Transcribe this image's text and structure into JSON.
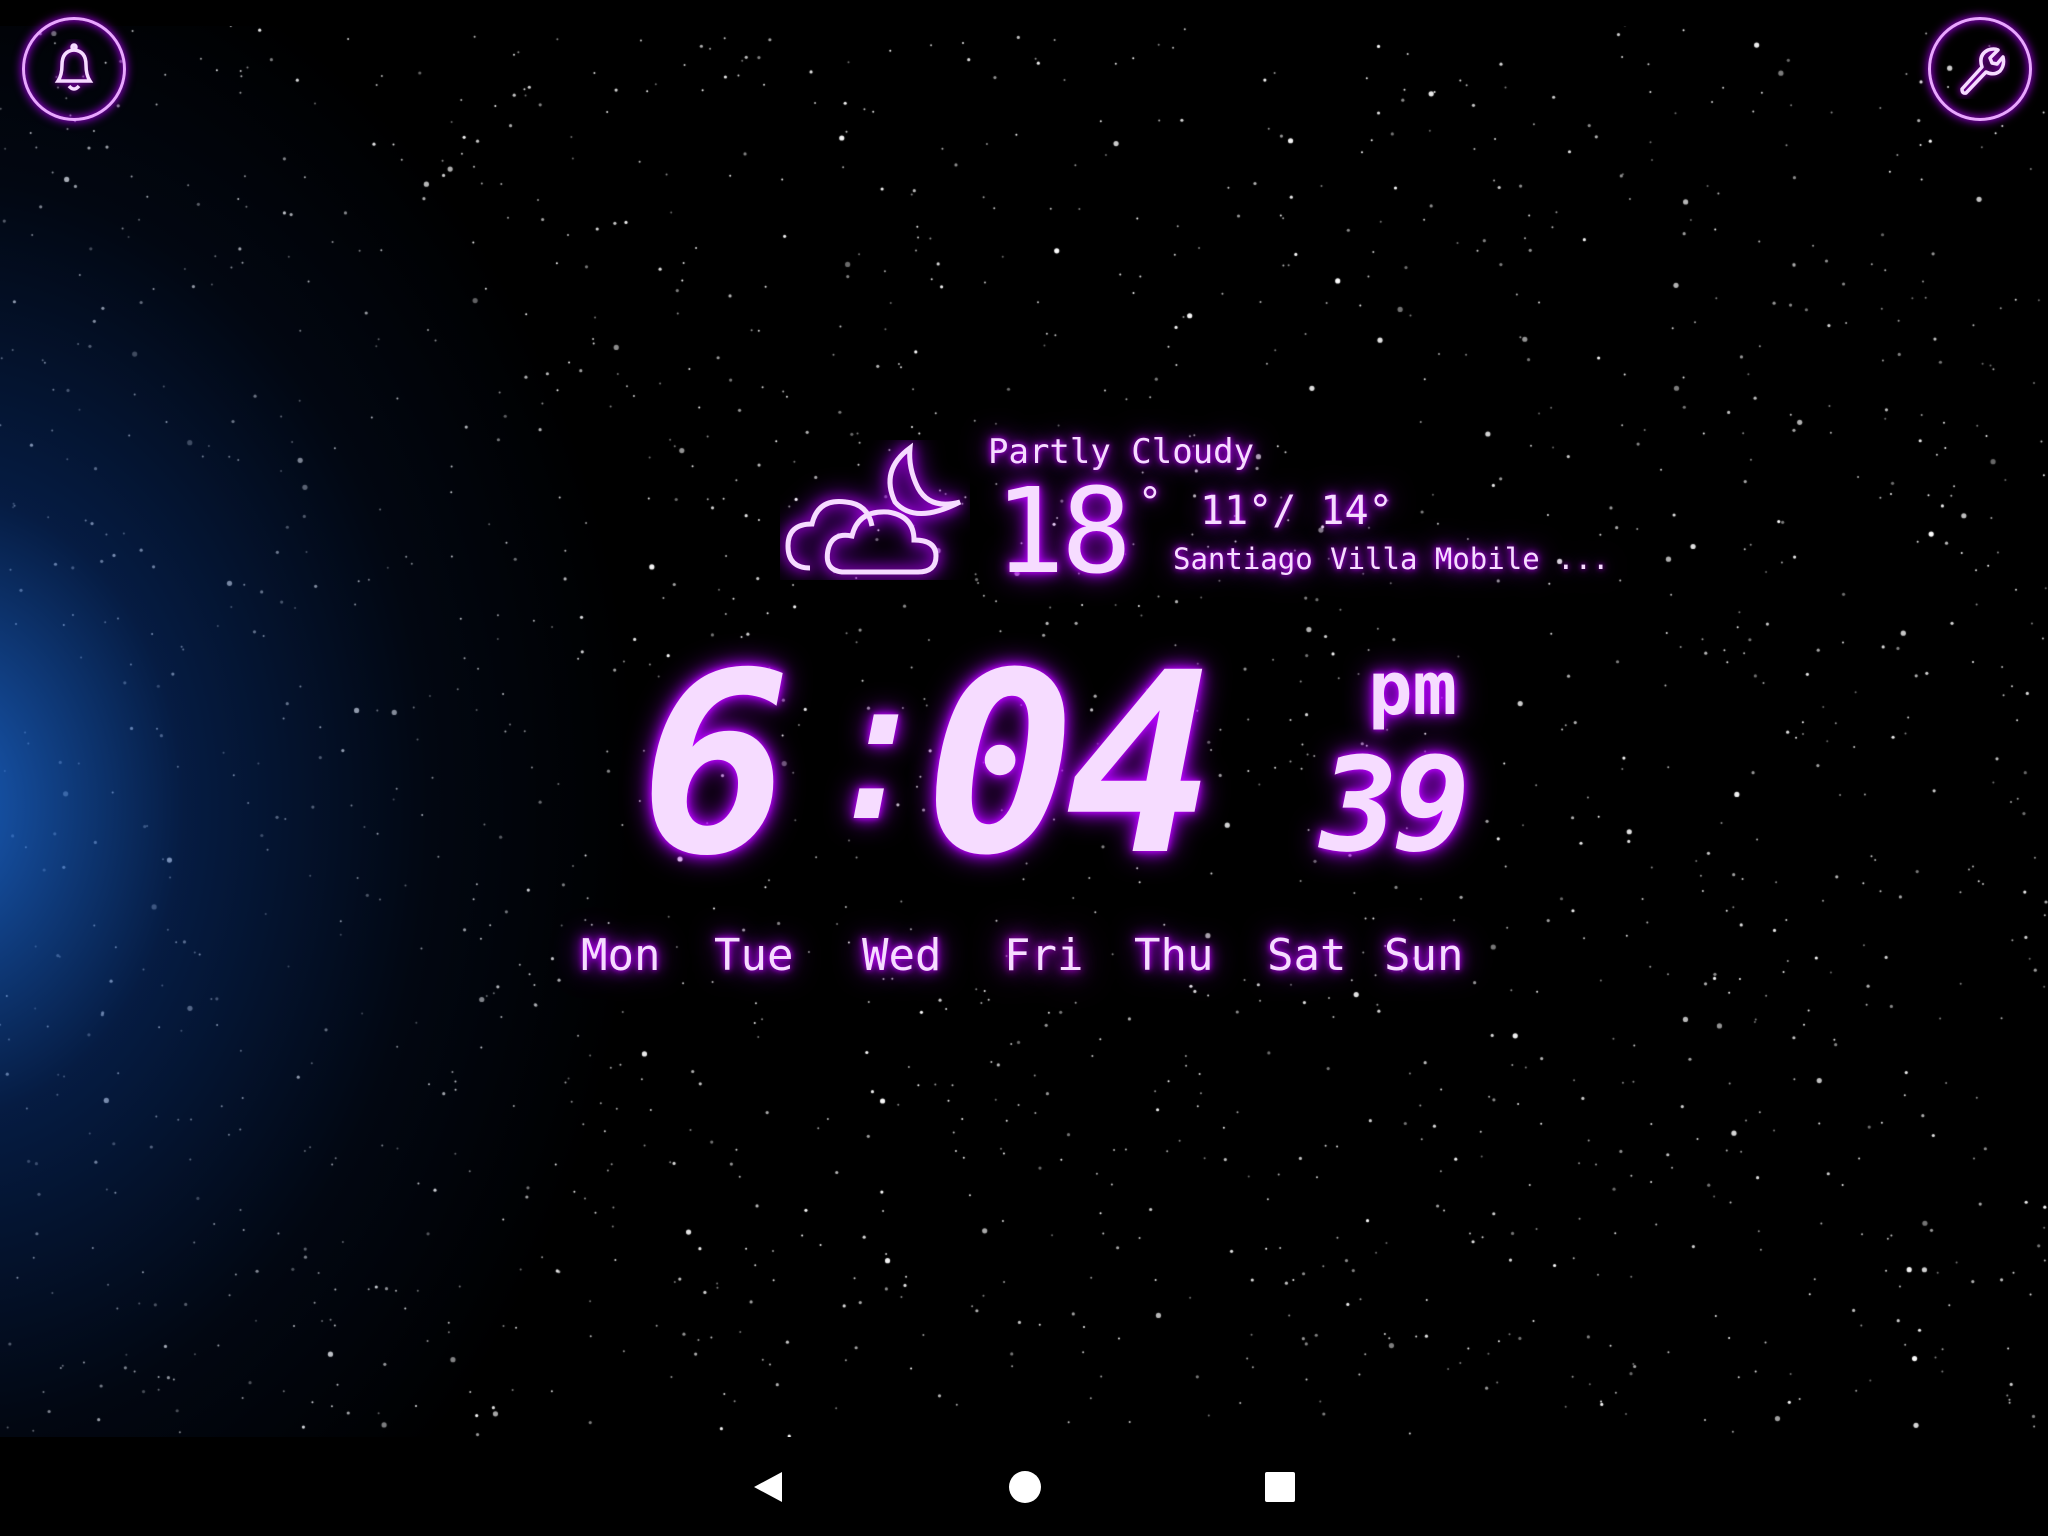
{
  "colors": {
    "accent": "#c000ff",
    "text": "#f6dcff",
    "left_glow": "#1e6edc"
  },
  "header": {
    "alarm_icon": "bell-icon",
    "settings_icon": "wrench-icon"
  },
  "weather": {
    "icon": "partly-cloudy-night-icon",
    "condition": "Partly Cloudy",
    "temperature": "18",
    "degree": "°",
    "low_high": "11°/ 14°",
    "location": "Santiago Villa Mobile ..."
  },
  "clock": {
    "hours": "6",
    "separator": ":",
    "minutes": "04",
    "ampm": "pm",
    "seconds": "39"
  },
  "days": [
    {
      "label": "Mon",
      "active": false
    },
    {
      "label": "Tue",
      "active": false
    },
    {
      "label": "Wed",
      "active": false
    },
    {
      "label": "Fri",
      "active": true
    },
    {
      "label": "Thu",
      "active": false
    },
    {
      "label": "Sat",
      "active": false
    },
    {
      "label": "Sun",
      "active": false
    }
  ],
  "navbar": {
    "back_icon": "back-triangle-icon",
    "home_icon": "home-circle-icon",
    "recents_icon": "recents-square-icon"
  }
}
